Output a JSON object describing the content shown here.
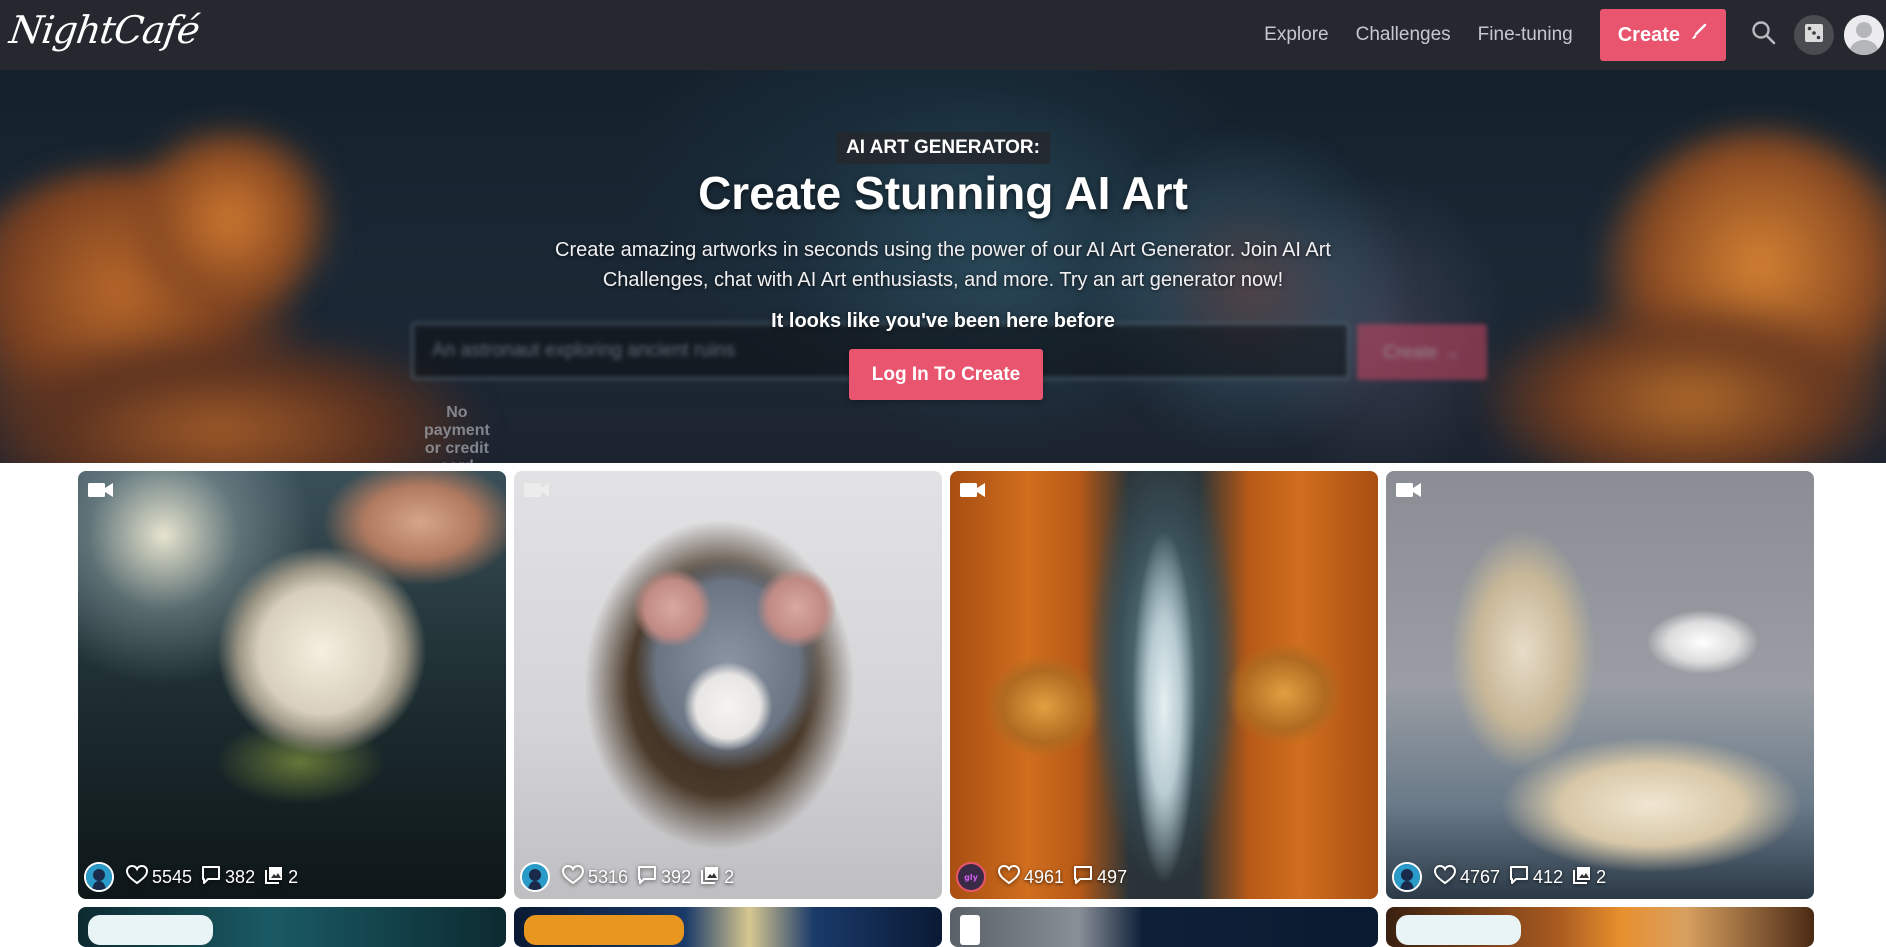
{
  "nav": {
    "logo": "NightCafé",
    "links": [
      "Explore",
      "Challenges",
      "Fine-tuning"
    ],
    "create_label": "Create",
    "icons": [
      "search-icon",
      "dice-icon",
      "user-avatar-icon"
    ]
  },
  "hero": {
    "eyebrow": "AI ART GENERATOR:",
    "title": "Create Stunning AI Art",
    "description": "Create amazing artworks in seconds using the power of our AI Art Generator. Join AI Art Challenges, chat with AI Art enthusiasts, and more. Try an art generator now!",
    "prompt_placeholder": "An astronaut exploring ancient ruins",
    "prompt_create_label": "Create →",
    "no_payment": "No payment or credit card required",
    "returning_notice": "It looks like you've been here before",
    "login_label": "Log In To Create"
  },
  "gallery": {
    "cards": [
      {
        "subject": "glowing moon held in hand in forest",
        "video": true,
        "likes": "5545",
        "comments": "382",
        "images": "2",
        "avatar": "blue-character",
        "colors": {
          "bg": "#1e2a2e",
          "accent": "#d8d2c0",
          "glow": "#f5e9c8"
        }
      },
      {
        "subject": "mouse in hood breaking through wall",
        "video": true,
        "likes": "5316",
        "comments": "392",
        "images": "2",
        "avatar": "blue-character",
        "colors": {
          "bg": "#cfd0d2",
          "accent": "#8e98a6",
          "glow": "#f0eeee"
        }
      },
      {
        "subject": "autumn leaf curtain revealing path",
        "video": true,
        "likes": "4961",
        "comments": "497",
        "images": null,
        "avatar": "pink-logo",
        "colors": {
          "bg": "#b35a18",
          "accent": "#e8882c",
          "glow": "#cfe0e6"
        }
      },
      {
        "subject": "pirate ship sailing from open book",
        "video": true,
        "likes": "4767",
        "comments": "412",
        "images": "2",
        "avatar": "blue-character",
        "colors": {
          "bg": "#8a8e94",
          "accent": "#efe4d0",
          "glow": "#2c3a48"
        }
      }
    ],
    "row2": [
      {
        "colors": {
          "bg": "#0f3a40",
          "pill": "#e8f4f6"
        }
      },
      {
        "colors": {
          "bg": "#10284a",
          "pill": "#e8961e"
        }
      },
      {
        "colors": {
          "bg": "#2a3a48",
          "pill": "#ffffff"
        }
      },
      {
        "colors": {
          "bg": "#6a3418",
          "pill": "#e8f4f6"
        }
      }
    ]
  },
  "colors": {
    "nav_bg": "#262830",
    "accent": "#e9546f",
    "nav_text": "#c6c8cf"
  }
}
